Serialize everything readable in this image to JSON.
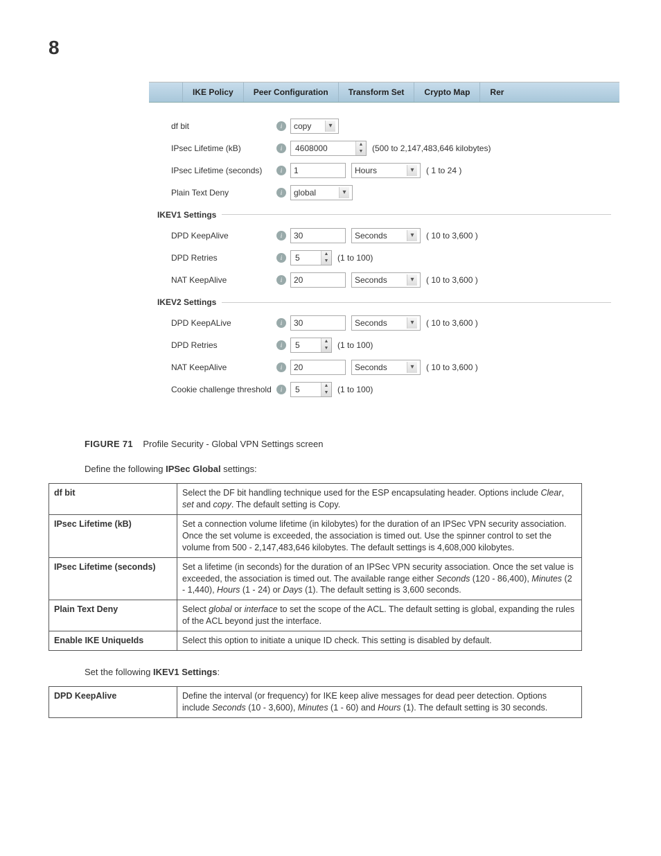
{
  "page_number": "8",
  "tabs": [
    "IKE Policy",
    "Peer Configuration",
    "Transform Set",
    "Crypto Map",
    "Rer"
  ],
  "fields": {
    "dfbit": {
      "label": "df bit",
      "value": "copy"
    },
    "ipseckb": {
      "label": "IPsec Lifetime (kB)",
      "value": "4608000",
      "hint": "(500 to 2,147,483,646 kilobytes)"
    },
    "ipsecsec": {
      "label": "IPsec Lifetime (seconds)",
      "value": "1",
      "unit": "Hours",
      "hint": "( 1 to 24 )"
    },
    "ptd": {
      "label": "Plain Text Deny",
      "value": "global"
    }
  },
  "sections": {
    "ikev1": {
      "title": "IKEV1 Settings",
      "dpdk": {
        "label": "DPD KeepAlive",
        "value": "30",
        "unit": "Seconds",
        "hint": "( 10 to 3,600 )"
      },
      "dpdr": {
        "label": "DPD Retries",
        "value": "5",
        "hint": "(1 to 100)"
      },
      "natk": {
        "label": "NAT KeepAlive",
        "value": "20",
        "unit": "Seconds",
        "hint": "( 10 to 3,600 )"
      }
    },
    "ikev2": {
      "title": "IKEV2 Settings",
      "dpdk": {
        "label": "DPD KeepALive",
        "value": "30",
        "unit": "Seconds",
        "hint": "( 10 to 3,600 )"
      },
      "dpdr": {
        "label": "DPD Retries",
        "value": "5",
        "hint": "(1 to 100)"
      },
      "natk": {
        "label": "NAT KeepAlive",
        "value": "20",
        "unit": "Seconds",
        "hint": "( 10 to 3,600 )"
      },
      "cct": {
        "label": "Cookie challenge threshold",
        "value": "5",
        "hint": "(1 to 100)"
      }
    }
  },
  "figure": {
    "num": "FIGURE 71",
    "caption": "Profile Security - Global VPN Settings screen"
  },
  "intro1_a": "Define the following ",
  "intro1_b": "IPSec Global",
  "intro1_c": " settings:",
  "table1": [
    {
      "k": "df bit",
      "v": "Select the DF bit handling technique used for the ESP encapsulating header. Options include <i>Clear</i>, <i>set</i> and <i>copy</i>. The default setting is Copy."
    },
    {
      "k": "IPsec Lifetime (kB)",
      "v": "Set a connection volume lifetime (in kilobytes) for the duration of an IPSec VPN security association. Once the set volume is exceeded, the association is timed out. Use the spinner control to set the volume from 500 - 2,147,483,646 kilobytes. The default settings is 4,608,000 kilobytes."
    },
    {
      "k": "IPsec Lifetime (seconds)",
      "v": "Set a lifetime (in seconds) for the duration of an IPSec VPN security association. Once the set value is exceeded, the association is timed out. The available range either <i>Seconds</i> (120 - 86,400), <i>Minutes</i> (2 - 1,440), <i>Hours</i> (1 - 24) or <i>Days</i> (1). The default setting is 3,600 seconds."
    },
    {
      "k": "Plain Text Deny",
      "v": "Select <i>global</i> or <i>interface</i> to set the scope of the ACL. The default setting is global, expanding the rules of the ACL beyond just the interface."
    },
    {
      "k": "Enable IKE UniqueIds",
      "v": "Select this option to initiate a unique ID check. This setting is disabled by default."
    }
  ],
  "intro2_a": "Set the following ",
  "intro2_b": "IKEV1 Settings",
  "intro2_c": ":",
  "table2": [
    {
      "k": "DPD KeepAlive",
      "v": "Define the interval (or frequency) for IKE keep alive messages for dead peer detection. Options include <i>Seconds</i> (10 - 3,600), <i>Minutes</i> (1 - 60) and <i>Hours</i> (1). The default setting is 30 seconds."
    }
  ]
}
